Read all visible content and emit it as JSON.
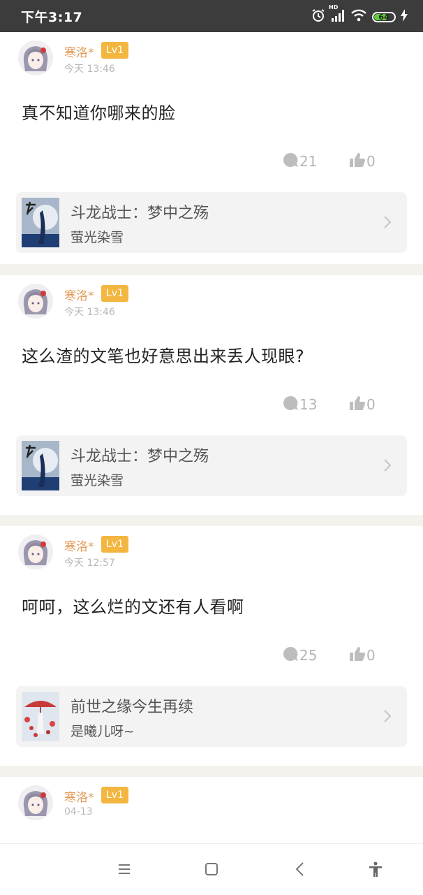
{
  "status_bar": {
    "time": "下午3:17",
    "hd_label": "HD",
    "battery_level": "64"
  },
  "posts": [
    {
      "username": "寒洛*",
      "level": "Lv1",
      "time": "今天 13:46",
      "content": "真不知道你哪来的脸",
      "comments": "21",
      "likes": "0",
      "book": {
        "title": "斗龙战士：梦中之殇",
        "author": "萤光染雪",
        "cover": "cover-dark-figure"
      }
    },
    {
      "username": "寒洛*",
      "level": "Lv1",
      "time": "今天 13:46",
      "content": "这么渣的文笔也好意思出来丢人现眼?",
      "comments": "13",
      "likes": "0",
      "book": {
        "title": "斗龙战士：梦中之殇",
        "author": "萤光染雪",
        "cover": "cover-dark-figure"
      }
    },
    {
      "username": "寒洛*",
      "level": "Lv1",
      "time": "今天 12:57",
      "content": "呵呵，这么烂的文还有人看啊",
      "comments": "25",
      "likes": "0",
      "book": {
        "title": "前世之缘今生再续",
        "author": "是曦儿呀~",
        "cover": "cover-red-umbrella"
      }
    },
    {
      "username": "寒洛*",
      "level": "Lv1",
      "time": "04-13"
    }
  ],
  "colors": {
    "username": "#e39a58",
    "level_badge": "#f3b640",
    "separator": "#f3f2ed",
    "status_bar": "#3c3c3c"
  },
  "nav_icons": [
    "menu-icon",
    "home-icon",
    "back-icon",
    "accessibility-icon"
  ]
}
